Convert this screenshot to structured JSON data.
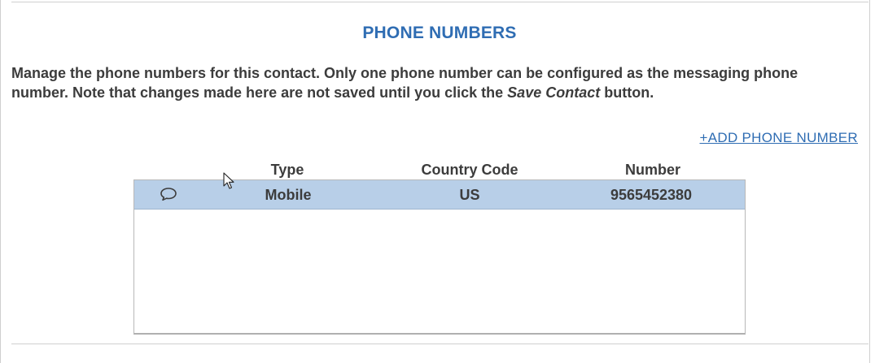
{
  "section": {
    "title": "PHONE NUMBERS",
    "description_part1": "Manage the phone numbers for this contact. Only one phone number can be configured as the messaging phone number. Note that changes made here are not saved until you click the ",
    "description_emphasis": "Save Contact",
    "description_part2": " button.",
    "add_link": "+ADD PHONE NUMBER"
  },
  "table": {
    "columns": [
      "Type",
      "Country Code",
      "Number"
    ],
    "rows": [
      {
        "icon": "message-bubble-icon",
        "type": "Mobile",
        "country_code": "US",
        "number": "9565452380"
      }
    ]
  },
  "colors": {
    "accent": "#2f6db3",
    "row_selected": "#b8cfe8"
  }
}
